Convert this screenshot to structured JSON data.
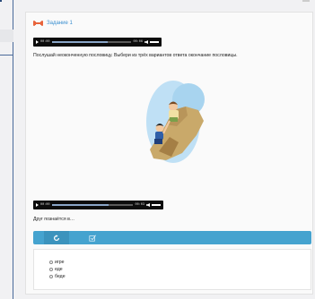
{
  "task": {
    "title": "Задание 1",
    "instruction": "Послушай неоконченную пословицу. Выбери из трёх вариантов ответа окончание пословицы.",
    "question": "Друг познаётся в…"
  },
  "player1": {
    "current_time": "00:00",
    "duration": "00:06",
    "progress": 0.7
  },
  "player2": {
    "current_time": "00:00",
    "duration": "00:03",
    "progress": 0.7
  },
  "toolbar": {
    "refresh_icon": "refresh-icon",
    "check_icon": "check-icon",
    "color": "#45a3cf"
  },
  "answers": [
    {
      "label": "игре"
    },
    {
      "label": "еде"
    },
    {
      "label": "беде"
    }
  ],
  "colors": {
    "accent": "#3a8fd0",
    "title_icon": "#e8643c"
  }
}
